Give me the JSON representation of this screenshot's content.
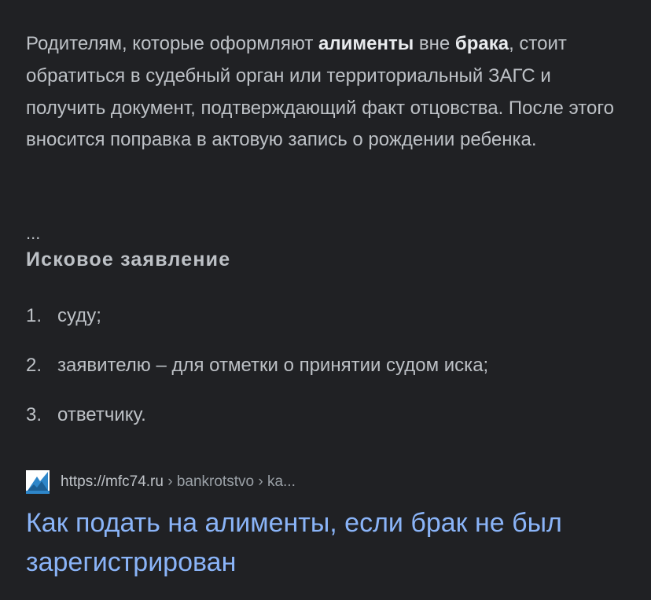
{
  "snippet": {
    "t1": "Родителям, которые оформляют ",
    "b1": "алименты",
    "t2": " вне ",
    "b2": "брака",
    "t3": ", стоит обратиться в судебный орган или территориальный ЗАГС и получить документ, подтверждающий факт отцовства. После этого вносится поправка в актовую запись о рождении ребенка."
  },
  "ellipsis": "...",
  "heading": "Исковое заявление",
  "list": [
    {
      "num": "1.",
      "text": "суду;"
    },
    {
      "num": "2.",
      "text": "заявителю – для отметки о принятии судом иска;"
    },
    {
      "num": "3.",
      "text": "ответчику."
    }
  ],
  "result": {
    "favicon_icon": "mfc74-logo-icon",
    "url_base": "https://mfc74.ru",
    "url_crumbs": " › bankrotstvo › ka...",
    "title": "Как подать на алименты, если брак не был зарегистрирован"
  },
  "colors": {
    "background": "#202124",
    "text": "#bdc1c6",
    "bold_text": "#e8eaed",
    "link": "#8ab4f8",
    "favicon_blue": "#2e86c9"
  }
}
